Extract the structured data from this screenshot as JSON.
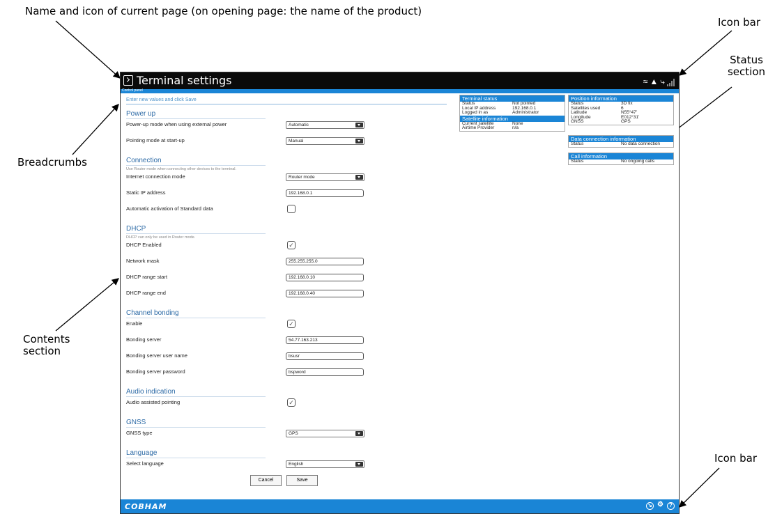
{
  "annotations": {
    "title_desc": "Name and icon of current page (on opening page: the name of the product)",
    "icon_bar_top": "Icon bar",
    "status_section": "Status section",
    "breadcrumbs": "Breadcrumbs",
    "contents_section": "Contents section",
    "icon_bar_bottom": "Icon bar"
  },
  "window": {
    "title": "Terminal settings",
    "breadcrumb": "Control panel",
    "hint": "Enter new values and click Save"
  },
  "form": {
    "power_up": {
      "heading": "Power up",
      "mode_label": "Power-up mode when using external power",
      "mode_value": "Automatic",
      "pointing_label": "Pointing mode at start-up",
      "pointing_value": "Manual"
    },
    "connection": {
      "heading": "Connection",
      "note": "Use Router mode when connecting other devices to the terminal.",
      "internet_label": "Internet connection mode",
      "internet_value": "Router mode",
      "static_ip_label": "Static IP address",
      "static_ip_value": "192.168.0.1",
      "auto_label": "Automatic activation of Standard data"
    },
    "dhcp": {
      "heading": "DHCP",
      "note": "DHCP can only be used in Router mode.",
      "enabled_label": "DHCP Enabled",
      "mask_label": "Network mask",
      "mask_value": "255.255.255.0",
      "start_label": "DHCP range start",
      "start_value": "192.168.0.10",
      "end_label": "DHCP range end",
      "end_value": "192.168.0.40"
    },
    "bonding": {
      "heading": "Channel bonding",
      "enable_label": "Enable",
      "server_label": "Bonding server",
      "server_value": "54.77.163.213",
      "user_label": "Bonding server user name",
      "user_value": "bsusr",
      "pass_label": "Bonding server password",
      "pass_value": "bspword"
    },
    "audio": {
      "heading": "Audio indication",
      "assist_label": "Audio assisted pointing"
    },
    "gnss": {
      "heading": "GNSS",
      "type_label": "GNSS type",
      "type_value": "GPS"
    },
    "language": {
      "heading": "Language",
      "select_label": "Select language",
      "select_value": "English"
    },
    "cancel": "Cancel",
    "save": "Save"
  },
  "status": {
    "terminal": {
      "heading": "Terminal status",
      "rows": [
        {
          "k": "Status",
          "v": "Not pointed"
        },
        {
          "k": "Local IP address",
          "v": "192.168.0.1"
        },
        {
          "k": "Logged in as",
          "v": "Administrator"
        }
      ]
    },
    "satellite": {
      "heading": "Satellite information",
      "rows": [
        {
          "k": "Current satellite",
          "v": "None"
        },
        {
          "k": "Airtime Provider",
          "v": "n/a"
        }
      ]
    },
    "position": {
      "heading": "Position information",
      "rows": [
        {
          "k": "Status",
          "v": "3D fix"
        },
        {
          "k": "Satellites used",
          "v": "6"
        },
        {
          "k": "Latitude",
          "v": "N55°47'"
        },
        {
          "k": "Longitude",
          "v": "E012°31'"
        },
        {
          "k": "GNSS",
          "v": "GPS"
        }
      ]
    },
    "data_conn": {
      "heading": "Data connection information",
      "rows": [
        {
          "k": "Status",
          "v": "No data connection"
        }
      ]
    },
    "call": {
      "heading": "Call information",
      "rows": [
        {
          "k": "Status",
          "v": "No ongoing calls"
        }
      ]
    }
  },
  "footer": {
    "logo": "COBHAM"
  },
  "icons": {
    "title": "terminal-icon",
    "top_bar": [
      "wifi-icon",
      "warning-icon",
      "satellite-icon",
      "signal-icon"
    ],
    "bottom_bar": [
      "gauge-icon",
      "settings-icon",
      "help-icon"
    ]
  },
  "colors": {
    "accent": "#1a85d6",
    "titlebar": "#0a0a0a"
  }
}
